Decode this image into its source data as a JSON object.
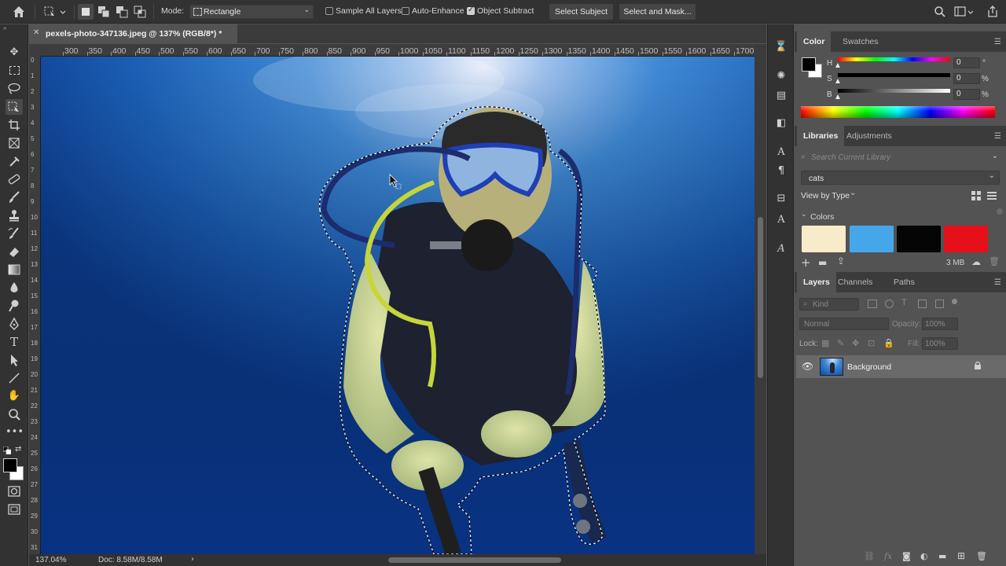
{
  "options_bar": {
    "mode_label": "Mode:",
    "mode_value": "Rectangle",
    "sample_all_layers": "Sample All Layers",
    "auto_enhance": "Auto-Enhance",
    "object_subtract": "Object Subtract",
    "select_subject": "Select Subject",
    "select_and_mask": "Select and Mask..."
  },
  "document": {
    "tab_title": "pexels-photo-347136.jpeg @ 137% (RGB/8*) *",
    "zoom": "137.04%",
    "doc_size": "Doc: 8.58M/8.58M"
  },
  "ruler": {
    "h_ticks": [
      "300",
      "350",
      "400",
      "450",
      "500",
      "550",
      "600",
      "650",
      "700",
      "750",
      "800",
      "850",
      "900",
      "950",
      "1000",
      "1050",
      "1100",
      "1150",
      "1200",
      "1250",
      "1300",
      "1350",
      "1400",
      "1450",
      "1500",
      "1550",
      "1600",
      "1650",
      "1700"
    ],
    "v_ticks": [
      "0",
      "1",
      "2",
      "3",
      "4",
      "5",
      "6",
      "7",
      "8",
      "9",
      "10",
      "11",
      "12",
      "13",
      "14",
      "15",
      "16",
      "17",
      "18",
      "19",
      "20",
      "21",
      "22",
      "23",
      "24",
      "25",
      "26",
      "27",
      "28",
      "29",
      "30",
      "31"
    ]
  },
  "color_panel": {
    "tabs": [
      "Color",
      "Swatches"
    ],
    "sliders": [
      {
        "label": "H",
        "value": "0",
        "unit": "°"
      },
      {
        "label": "S",
        "value": "0",
        "unit": "%"
      },
      {
        "label": "B",
        "value": "0",
        "unit": "%"
      }
    ]
  },
  "libraries_panel": {
    "tabs": [
      "Libraries",
      "Adjustments"
    ],
    "search_placeholder": "Search Current Library",
    "library": "cats",
    "view_by": "View by Type",
    "colors_header": "Colors",
    "swatches": [
      "#f7ebc9",
      "#45a7ea",
      "#050505",
      "#e5101a"
    ],
    "storage": "3 MB"
  },
  "layers_panel": {
    "tabs": [
      "Layers",
      "Channels",
      "Paths"
    ],
    "filter_kind": "Kind",
    "blend_mode": "Normal",
    "opacity_label": "Opacity:",
    "opacity_value": "100%",
    "lock_label": "Lock:",
    "fill_label": "Fill:",
    "fill_value": "100%",
    "layers": [
      {
        "name": "Background",
        "visible": true,
        "locked": true
      }
    ]
  },
  "colors": {
    "accent": "#1473e6",
    "panel_bg": "#535353",
    "chrome": "#323232"
  }
}
